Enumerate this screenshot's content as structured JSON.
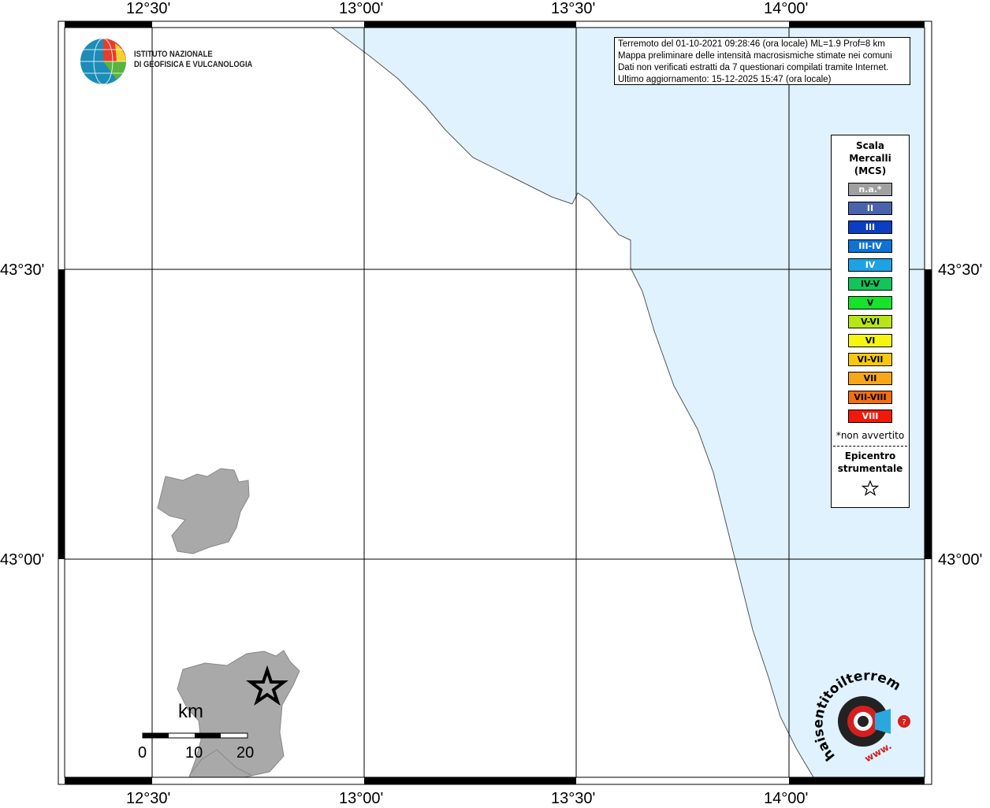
{
  "map": {
    "lon_labels": [
      "12°30'",
      "13°00'",
      "13°30'",
      "14°00'"
    ],
    "lat_labels": [
      "43°30'",
      "43°00'"
    ]
  },
  "logo_ingv": {
    "line1": "ISTITUTO NAZIONALE",
    "line2": "DI GEOFISICA E VULCANOLOGIA"
  },
  "info_box": {
    "line1": "Terremoto del 01-10-2021 09:28:46 (ora locale) ML=1.9 Prof=8 km",
    "line2": "Mappa preliminare delle intensità macrosismiche stimate nei comuni",
    "line3": "Dati non verificati estratti da 7 questionari compilati tramite Internet.",
    "line4": "Ultimo aggiornamento: 15-12-2025 15:47 (ora locale)"
  },
  "legend": {
    "title_lines": [
      "Scala",
      "Mercalli",
      "(MCS)"
    ],
    "items": [
      {
        "label": "n.a.*",
        "color": "#a0a0a0",
        "text_color": "#ffffff"
      },
      {
        "label": "II",
        "color": "#4a63ab",
        "text_color": "#ffffff"
      },
      {
        "label": "III",
        "color": "#0a3fc4",
        "text_color": "#ffffff"
      },
      {
        "label": "III-IV",
        "color": "#0f73d6",
        "text_color": "#ffffff"
      },
      {
        "label": "IV",
        "color": "#1ea2e6",
        "text_color": "#ffffff"
      },
      {
        "label": "IV-V",
        "color": "#12c45a",
        "text_color": "#000000"
      },
      {
        "label": "V",
        "color": "#16e32a",
        "text_color": "#000000"
      },
      {
        "label": "V-VI",
        "color": "#b7e516",
        "text_color": "#000000"
      },
      {
        "label": "VI",
        "color": "#f5f50f",
        "text_color": "#000000"
      },
      {
        "label": "VI-VII",
        "color": "#f7c80f",
        "text_color": "#000000"
      },
      {
        "label": "VII",
        "color": "#f7a617",
        "text_color": "#000000"
      },
      {
        "label": "VII-VIII",
        "color": "#f56e0f",
        "text_color": "#000000"
      },
      {
        "label": "VIII",
        "color": "#f01a0a",
        "text_color": "#ffffff"
      }
    ],
    "note": "*non avvertito",
    "epicenter_lines": [
      "Epicentro",
      "strumentale"
    ]
  },
  "scale_bar": {
    "unit": "km",
    "labels": [
      "0",
      "10",
      "20"
    ]
  },
  "logo_hsit": {
    "text": "haisentitoilterremoto.it",
    "url_text": "www."
  },
  "colors": {
    "sea": "#e0f2fd",
    "land_shaded": "#a9a9a9",
    "grid": "#000000"
  }
}
